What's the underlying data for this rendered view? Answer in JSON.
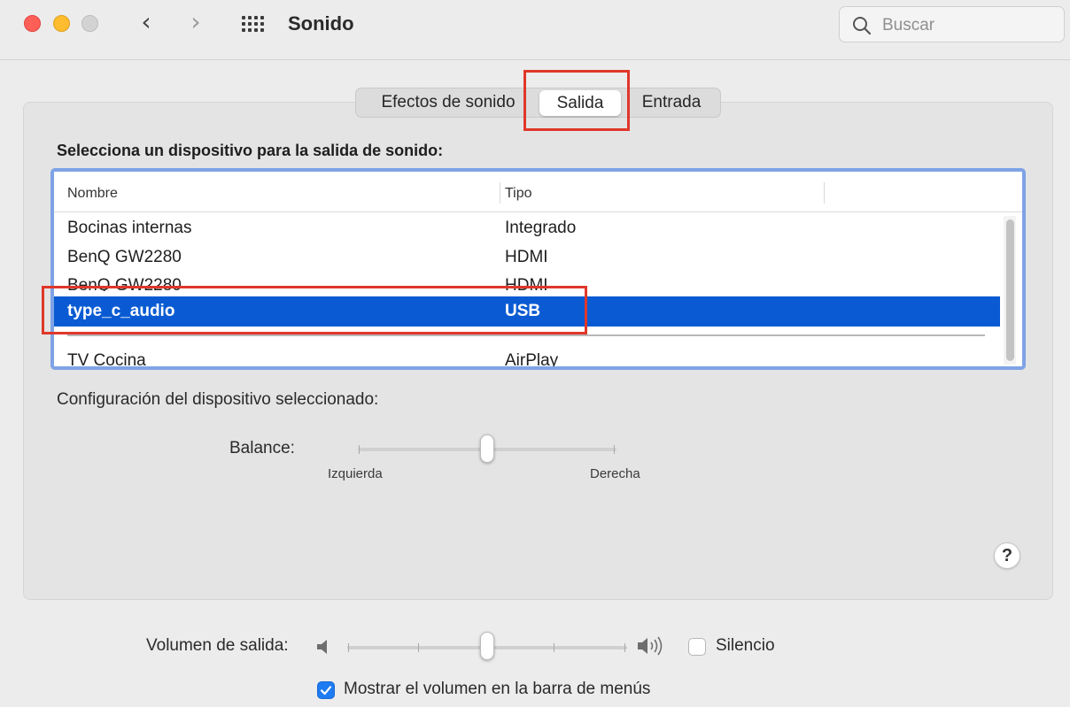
{
  "window": {
    "title": "Sonido",
    "search_placeholder": "Buscar",
    "back_symbol": "‹",
    "forward_symbol": "›"
  },
  "tabs": [
    {
      "label": "Efectos de sonido",
      "selected": false
    },
    {
      "label": "Salida",
      "selected": true
    },
    {
      "label": "Entrada",
      "selected": false
    }
  ],
  "output": {
    "heading": "Selecciona un dispositivo para la salida de sonido:",
    "columns": {
      "name": "Nombre",
      "type": "Tipo"
    },
    "devices": [
      {
        "name": "Bocinas internas",
        "type": "Integrado"
      },
      {
        "name": "BenQ GW2280",
        "type": "HDMI"
      },
      {
        "name": "BenQ GW2280",
        "type": "HDMI"
      },
      {
        "name": "type_c_audio",
        "type": "USB",
        "selected": true
      },
      {
        "name": "TV Cocina",
        "type": "AirPlay"
      }
    ]
  },
  "settings": {
    "heading": "Configuración del dispositivo seleccionado:",
    "balance_label": "Balance:",
    "balance_left": "Izquierda",
    "balance_right": "Derecha",
    "balance_value": 0.5,
    "help_symbol": "?"
  },
  "volume": {
    "label": "Volumen de salida:",
    "value": 0.5,
    "mute_label": "Silencio",
    "mute_checked": false,
    "show_in_menubar_label": "Mostrar el volumen en la barra de menús",
    "show_in_menubar_checked": true
  },
  "colors": {
    "selection": "#0a5bd3",
    "highlight_annotation": "#e0372a",
    "focus_ring": "#7ea3e6",
    "checkbox_accent": "#1f7bf2"
  }
}
